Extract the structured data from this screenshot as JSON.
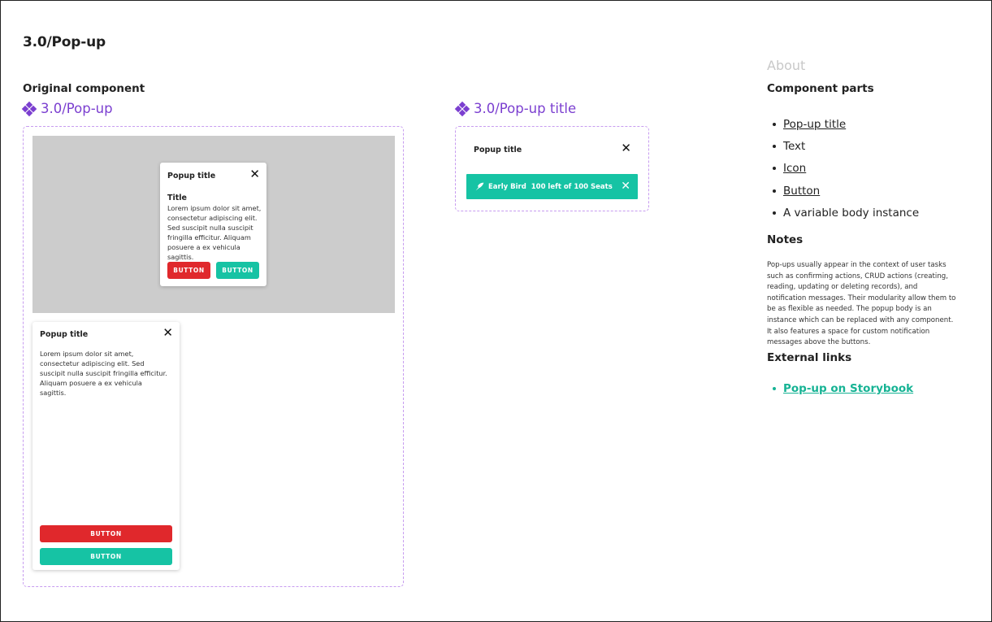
{
  "page": {
    "title": "3.0/Pop-up",
    "section_label": "Original component"
  },
  "component_popup": {
    "label": "3.0/Pop-up",
    "example_dialog": {
      "title": "Popup title",
      "subtitle": "Title",
      "body": "Lorem ipsum dolor sit amet, consectetur adipiscing elit. Sed suscipit nulla suscipit fringilla efficitur. Aliquam posuere a ex vehicula sagittis.",
      "buttons": [
        "BUTTON",
        "BUTTON"
      ],
      "close_icon": "close-icon"
    },
    "example_panel": {
      "title": "Popup title",
      "body": "Lorem ipsum dolor sit amet, consectetur adipiscing elit. Sed suscipit nulla suscipit fringilla efficitur. Aliquam posuere a ex vehicula sagittis.",
      "buttons": [
        "BUTTON",
        "BUTTON"
      ],
      "close_icon": "close-icon"
    }
  },
  "component_popup_title": {
    "label": "3.0/Pop-up title",
    "title": "Popup title",
    "notification": {
      "icon": "bird-icon",
      "text": "Early Bird  100 left of 100 Seats"
    }
  },
  "sidebar": {
    "about": "About",
    "parts_heading": "Component parts",
    "parts": [
      {
        "label": "Pop-up title",
        "link": true
      },
      {
        "label": "Text",
        "link": false
      },
      {
        "label": "Icon",
        "link": true
      },
      {
        "label": "Button",
        "link": true
      },
      {
        "label": "A variable body instance",
        "link": false
      }
    ],
    "notes_heading": "Notes",
    "notes": "Pop-ups usually appear in the context of user tasks such as confirming actions, CRUD actions (creating, reading, updating or deleting records), and notification messages. Their modularity allow them to be as flexible as needed. The popup body is an instance which can be replaced with any component. It also features a space for custom notification messages above the buttons.",
    "external_heading": "External links",
    "external_links": [
      "Pop-up on Storybook"
    ]
  },
  "colors": {
    "accent_purple": "#7b3fd0",
    "button_red": "#e0282c",
    "button_teal": "#16c3a4",
    "link_teal": "#16b394"
  }
}
